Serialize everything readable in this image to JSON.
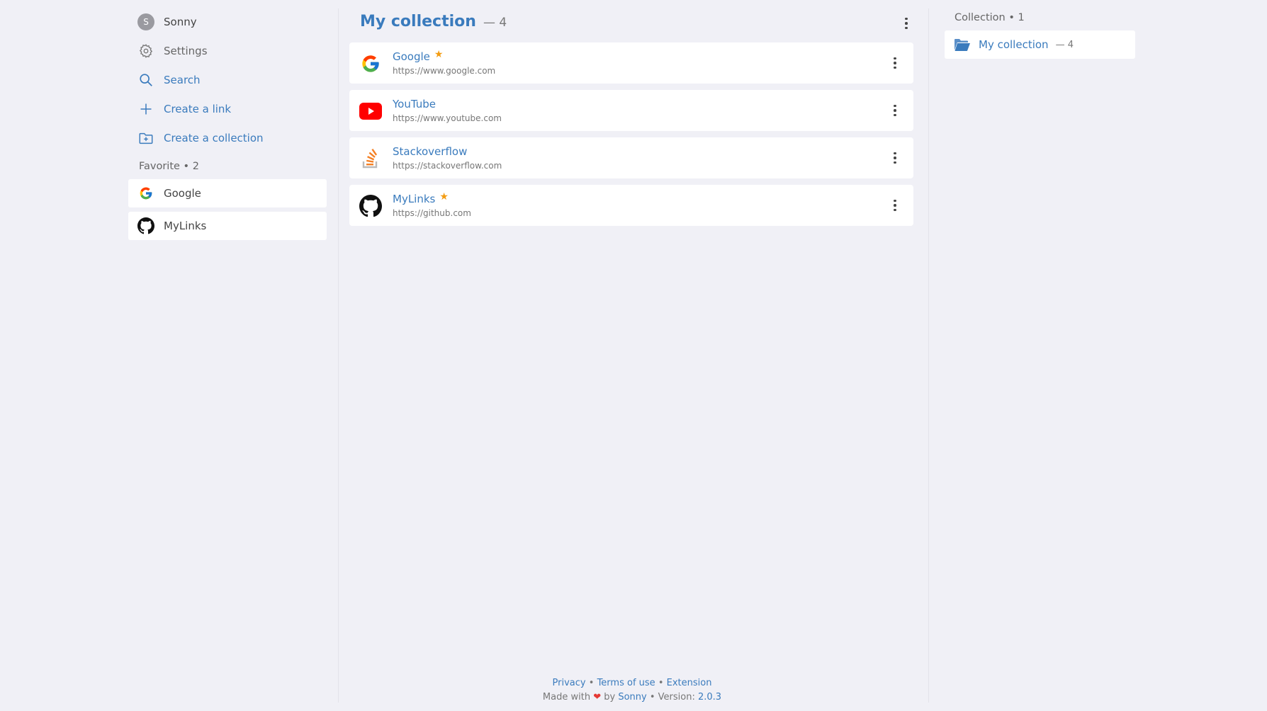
{
  "sidebar": {
    "user": {
      "name": "Sonny",
      "avatar_letter": "S"
    },
    "nav": [
      {
        "label": "Settings",
        "icon": "gear-icon"
      },
      {
        "label": "Search",
        "icon": "search-icon"
      },
      {
        "label": "Create a link",
        "icon": "plus-icon"
      },
      {
        "label": "Create a collection",
        "icon": "folder-plus-icon"
      }
    ],
    "favorites_label": "Favorite • 2",
    "favorites": [
      {
        "label": "Google",
        "icon": "google-icon"
      },
      {
        "label": "MyLinks",
        "icon": "github-icon"
      }
    ]
  },
  "main": {
    "title": "My collection",
    "count": "— 4",
    "links": [
      {
        "name": "Google",
        "url": "https://www.google.com",
        "favorite": true,
        "icon": "google-icon"
      },
      {
        "name": "YouTube",
        "url": "https://www.youtube.com",
        "favorite": false,
        "icon": "youtube-icon"
      },
      {
        "name": "Stackoverflow",
        "url": "https://stackoverflow.com",
        "favorite": false,
        "icon": "stackoverflow-icon"
      },
      {
        "name": "MyLinks",
        "url": "https://github.com",
        "favorite": true,
        "icon": "github-icon"
      }
    ],
    "star_glyph": "★",
    "footer": {
      "privacy": "Privacy",
      "sep": "•",
      "terms": "Terms of use",
      "extension": "Extension",
      "made_with": "Made with",
      "heart": "❤",
      "by": "by",
      "author": "Sonny",
      "version_label": "• Version:",
      "version": "2.0.3"
    }
  },
  "right": {
    "collections_label": "Collection • 1",
    "collections": [
      {
        "name": "My collection",
        "count": "— 4",
        "icon": "folder-open-icon"
      }
    ]
  },
  "colors": {
    "accent": "#3a7bbd",
    "star": "#f39c12",
    "background": "#f0f0f6"
  }
}
